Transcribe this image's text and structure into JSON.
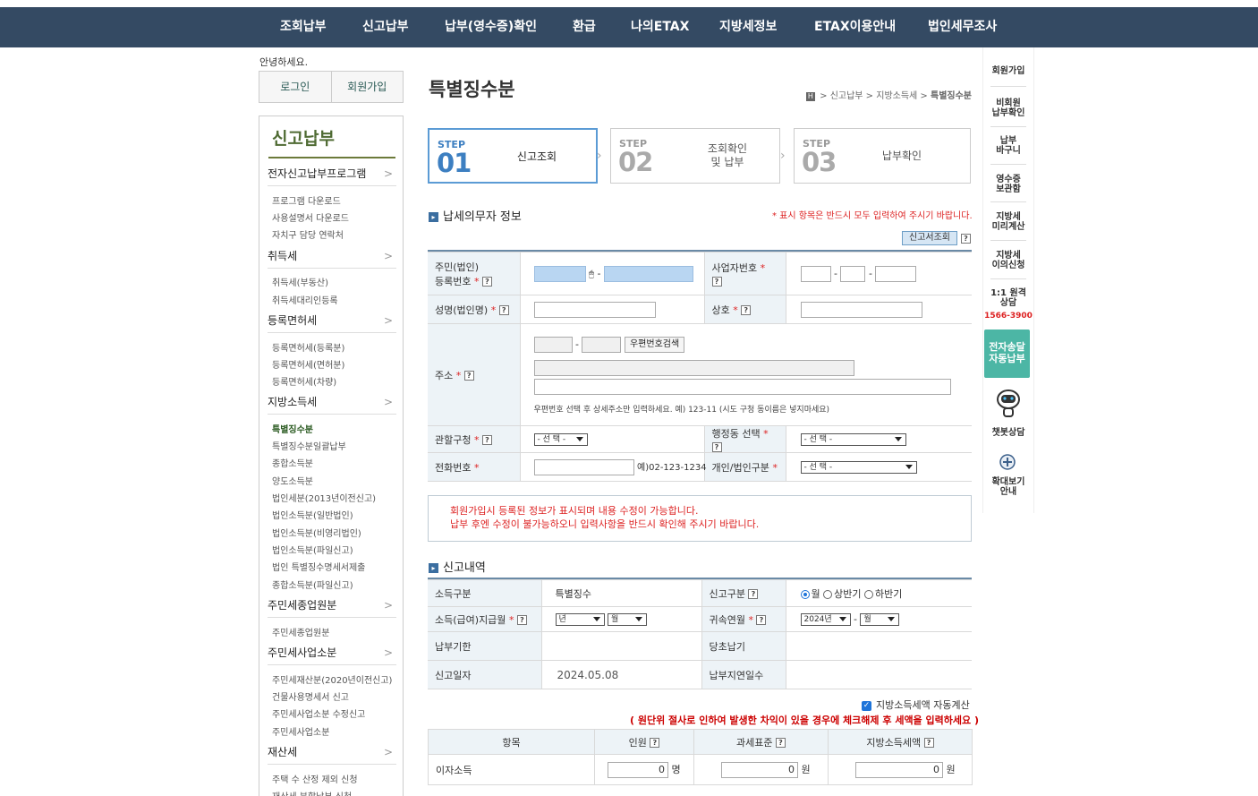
{
  "gnb": [
    "조회납부",
    "신고납부",
    "납부(영수증)확인",
    "환급",
    "나의ETAX",
    "지방세정보",
    "ETAX이용안내",
    "법인세무조사"
  ],
  "greeting": "안녕하세요.",
  "login": {
    "login_label": "로그인",
    "join_label": "회원가입"
  },
  "lnb": {
    "title": "신고납부",
    "sections": [
      {
        "label": "전자신고납부프로그램",
        "items": [
          "프로그램 다운로드",
          "사용설명서 다운로드",
          "자치구 담당 연락처"
        ]
      },
      {
        "label": "취득세",
        "items": [
          "취득세(부동산)",
          "취득세대리인등록"
        ]
      },
      {
        "label": "등록면허세",
        "items": [
          "등록면허세(등록분)",
          "등록면허세(면허분)",
          "등록면허세(차량)"
        ]
      },
      {
        "label": "지방소득세",
        "items": [
          "특별징수분",
          "특별징수분일괄납부",
          "종합소득분",
          "양도소득분",
          "법인세분(2013년이전신고)",
          "법인소득분(일반법인)",
          "법인소득분(비영리법인)",
          "법인소득분(파일신고)",
          "법인 특별징수명세서제출",
          "종합소득분(파일신고)"
        ]
      },
      {
        "label": "주민세종업원분",
        "items": [
          "주민세종업원분"
        ]
      },
      {
        "label": "주민세사업소분",
        "items": [
          "주민세재산분(2020년이전신고)",
          "건물사용명세서 신고",
          "주민세사업소분 수정신고",
          "주민세사업소분"
        ]
      },
      {
        "label": "재산세",
        "items": [
          "주택 수 산정 제외 신청",
          "재산세 분할납부 신청"
        ]
      }
    ]
  },
  "page": {
    "title": "특별징수분",
    "breadcrumb": [
      "H",
      "신고납부",
      "지방소득세",
      "특별징수분"
    ]
  },
  "steps": [
    {
      "label": "STEP",
      "num": "01",
      "text": "신고조회",
      "active": true
    },
    {
      "label": "STEP",
      "num": "02",
      "text": "조회확인\n및 납부",
      "active": false
    },
    {
      "label": "STEP",
      "num": "03",
      "text": "납부확인",
      "active": false
    }
  ],
  "taxpayer": {
    "section_title": "납세의무자 정보",
    "notice": "* 표시 항목은 반드시 모두 입력하여 주시기 바랍니다.",
    "search_btn": "신고서조회",
    "regno_label": "주민(법인)\n등록번호",
    "bizno_label": "사업자번호",
    "name_label": "성명(법인명)",
    "company_label": "상호",
    "address_label": "주소",
    "zip_btn": "우편번호검색",
    "address_hint": "우편번호 선택 후 상세주소만 입력하세요. 예) 123-11 (시도 구청 동이름은 넣지마세요)",
    "district_label": "관할구청",
    "district_value": "- 선 택 -",
    "dong_label": "행정동 선택",
    "dong_value": "- 선 택 -",
    "phone_label": "전화번호",
    "phone_example": "예)02-123-1234",
    "personal_label": "개인/법인구분",
    "personal_value": "- 선 택 -"
  },
  "message": [
    "회원가입시 등록된 정보가 표시되며 내용 수정이 가능합니다.",
    "납부 후엔 수정이 불가능하오니 입력사항을 반드시 확인해 주시기 바랍니다."
  ],
  "report": {
    "section_title": "신고내역",
    "income_type_label": "소득구분",
    "income_type_value": "특별징수",
    "report_type_label": "신고구분",
    "report_options": [
      "월",
      "상반기",
      "하반기"
    ],
    "pay_month_label": "소득(급여)지급월",
    "year_sel": "년",
    "month_sel": "월",
    "belong_label": "귀속연월",
    "belong_year": "2024년",
    "belong_month": "월",
    "due_label": "납부기한",
    "orig_label": "당초납기",
    "report_date_label": "신고일자",
    "report_date_value": "2024.05.08",
    "late_label": "납부지연일수"
  },
  "calc": {
    "auto_label": "지방소득세액 자동계산",
    "note": "( 원단위 절사로 인하여 발생한 차익이 있을 경우에 체크해제 후 세액을 입력하세요 )",
    "headers": [
      "항목",
      "인원",
      "과세표준",
      "지방소득세액"
    ],
    "rows": [
      {
        "label": "이자소득",
        "count": "0",
        "count_unit": "명",
        "base": "0",
        "base_unit": "원",
        "tax": "0",
        "tax_unit": "원"
      }
    ]
  },
  "rside": [
    "회원가입",
    "비회원\n납부확인",
    "납부\n바구니",
    "영수증\n보관함",
    "지방세\n미리계산",
    "지방세\n이의신청",
    "1:1 원격\n상담",
    "1566-3900",
    "전자송달\n자동납부",
    "챗봇상담",
    "확대보기\n안내"
  ]
}
